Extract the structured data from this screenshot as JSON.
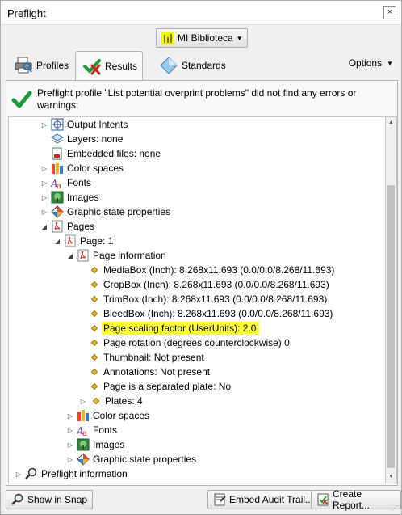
{
  "window": {
    "title": "Preflight",
    "close_label": "×"
  },
  "library": {
    "label": "MI Biblioteca"
  },
  "tabs": [
    {
      "label": "Profiles",
      "icon": "profiles-icon"
    },
    {
      "label": "Results",
      "icon": "results-icon",
      "active": true
    },
    {
      "label": "Standards",
      "icon": "standards-icon"
    }
  ],
  "options": {
    "label": "Options"
  },
  "summary": {
    "message": "Preflight profile \"List potential overprint problems\" did not find any errors or warnings:"
  },
  "tree": {
    "output_intents": "Output Intents",
    "layers": "Layers: none",
    "embedded_files": "Embedded files: none",
    "color_spaces": "Color spaces",
    "fonts": "Fonts",
    "images": "Images",
    "graphic_state": "Graphic state properties",
    "pages": "Pages",
    "page1": "Page: 1",
    "page_information": "Page information",
    "media_box": "MediaBox (Inch): 8.268x11.693 (0.0/0.0/8.268/11.693)",
    "crop_box": "CropBox (Inch): 8.268x11.693 (0.0/0.0/8.268/11.693)",
    "trim_box": "TrimBox (Inch): 8.268x11.693 (0.0/0.0/8.268/11.693)",
    "bleed_box": "BleedBox (Inch): 8.268x11.693 (0.0/0.0/8.268/11.693)",
    "page_scaling": "Page scaling factor (UserUnits): 2.0",
    "page_rotation": "Page rotation (degrees counterclockwise) 0",
    "thumbnail": "Thumbnail: Not present",
    "annotations": "Annotations: Not present",
    "separated_plate": "Page is a separated plate: No",
    "plates": "Plates: 4",
    "page_color_spaces": "Color spaces",
    "page_fonts": "Fonts",
    "page_images": "Images",
    "page_graphic_state": "Graphic state properties",
    "preflight_information": "Preflight information"
  },
  "buttons": {
    "show_in_snap": "Show in Snap",
    "embed_audit_trail": "Embed Audit Trail...",
    "create_report": "Create Report..."
  },
  "colors": {
    "highlight": "#ffff3a",
    "check_green": "#1a9a3a",
    "pdf_red": "#c8281e"
  }
}
